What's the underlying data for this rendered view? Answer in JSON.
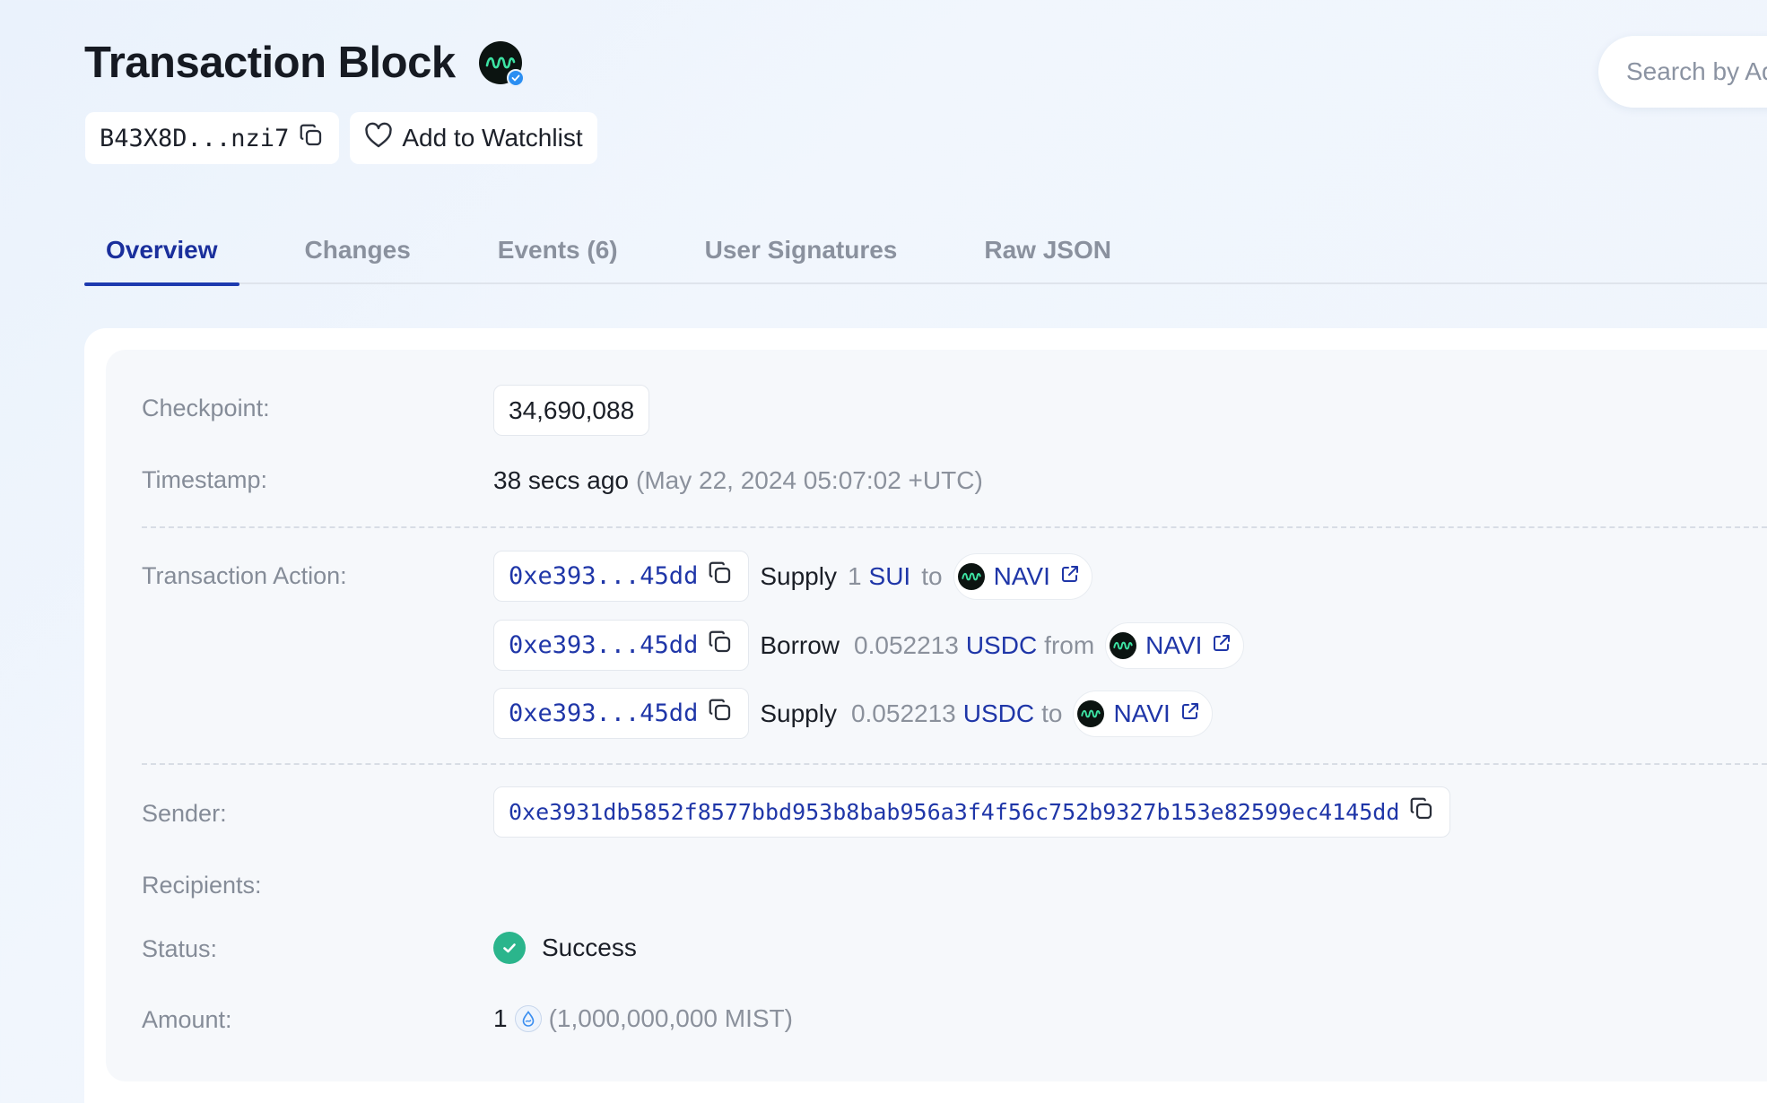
{
  "header": {
    "title": "Transaction Block",
    "digest_short": "B43X8D...nzi7",
    "watchlist_label": "Add to Watchlist",
    "search_placeholder": "Search by Address / Package / Object ID"
  },
  "tabs": [
    {
      "label": "Overview",
      "active": true
    },
    {
      "label": "Changes",
      "active": false
    },
    {
      "label": "Events (6)",
      "active": false
    },
    {
      "label": "User Signatures",
      "active": false
    },
    {
      "label": "Raw JSON",
      "active": false
    }
  ],
  "overview": {
    "checkpoint": {
      "label": "Checkpoint:",
      "value": "34,690,088"
    },
    "timestamp": {
      "label": "Timestamp:",
      "relative": "38 secs ago",
      "absolute": "(May 22, 2024 05:07:02 +UTC)"
    },
    "transaction_action": {
      "label": "Transaction Action:",
      "actions": [
        {
          "address": "0xe393...45dd",
          "verb": "Supply",
          "amount": "1",
          "token": "SUI",
          "preposition": "to",
          "protocol": "NAVI"
        },
        {
          "address": "0xe393...45dd",
          "verb": "Borrow",
          "amount": "0.052213",
          "token": "USDC",
          "preposition": "from",
          "protocol": "NAVI"
        },
        {
          "address": "0xe393...45dd",
          "verb": "Supply",
          "amount": "0.052213",
          "token": "USDC",
          "preposition": "to",
          "protocol": "NAVI"
        }
      ]
    },
    "sender": {
      "label": "Sender:",
      "value": "0xe3931db5852f8577bbd953b8bab956a3f4f56c752b9327b153e82599ec4145dd"
    },
    "recipients": {
      "label": "Recipients:"
    },
    "status": {
      "label": "Status:",
      "value": "Success"
    },
    "amount": {
      "label": "Amount:",
      "value": "1",
      "detail": "(1,000,000,000 MIST)"
    }
  },
  "colors": {
    "accent": "#1f36a8",
    "success": "#2bb58c",
    "label": "#858c98"
  },
  "icons": [
    "navi-logo-icon",
    "verified-check-icon",
    "copy-icon",
    "heart-icon",
    "external-link-icon",
    "success-check-icon",
    "sui-drop-icon"
  ]
}
